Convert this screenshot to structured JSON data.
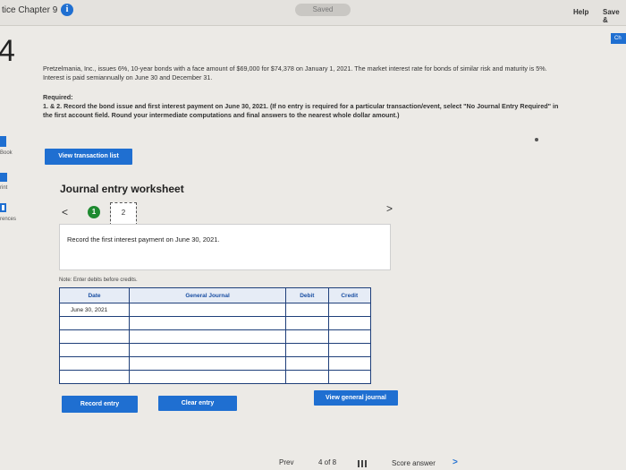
{
  "header": {
    "chapter_title": "tice Chapter 9",
    "info_glyph": "i",
    "saved_label": "Saved",
    "help_label": "Help",
    "save_label": "Save &",
    "ch_label": "Ch"
  },
  "question": {
    "number": "4",
    "problem_text": "Pretzelmania, Inc., issues 6%, 10-year bonds with a face amount of $69,000 for $74,378 on January 1, 2021. The market interest rate for bonds of similar risk and maturity is 5%. Interest is paid semiannually on June 30 and December 31.",
    "required_heading": "Required:",
    "required_text_plain": "1. & 2. Record the bond issue and first interest payment on June 30, 2021. ",
    "required_text_bold": "(If no entry is required for a particular transaction/event, select \"No Journal Entry Required\" in the first account field. Round your intermediate computations and final answers to the nearest whole dollar amount.)"
  },
  "sidebar": {
    "items": [
      {
        "label": "Book"
      },
      {
        "label": "rint"
      },
      {
        "label": "rences"
      }
    ]
  },
  "buttons": {
    "view_transaction_list": "View transaction list",
    "record_entry": "Record entry",
    "clear_entry": "Clear entry",
    "view_general_journal": "View general journal"
  },
  "worksheet": {
    "title": "Journal entry worksheet",
    "prev_glyph": "<",
    "next_glyph": ">",
    "steps": [
      "1",
      "2"
    ],
    "description": "Record the first interest payment on June 30, 2021.",
    "note": "Note: Enter debits before credits."
  },
  "journal_table": {
    "headers": [
      "Date",
      "General Journal",
      "Debit",
      "Credit"
    ],
    "rows": [
      [
        "June 30, 2021",
        "",
        "",
        ""
      ],
      [
        "",
        "",
        "",
        ""
      ],
      [
        "",
        "",
        "",
        ""
      ],
      [
        "",
        "",
        "",
        ""
      ],
      [
        "",
        "",
        "",
        ""
      ],
      [
        "",
        "",
        "",
        ""
      ]
    ]
  },
  "footer": {
    "prev_label": "Prev",
    "page_label": "4 of 8",
    "score_answer": "Score answer",
    "next_glyph": ">"
  },
  "colors": {
    "accent": "#1f6fd1",
    "step_complete": "#1e8a30",
    "table_border": "#1f3f7a"
  }
}
